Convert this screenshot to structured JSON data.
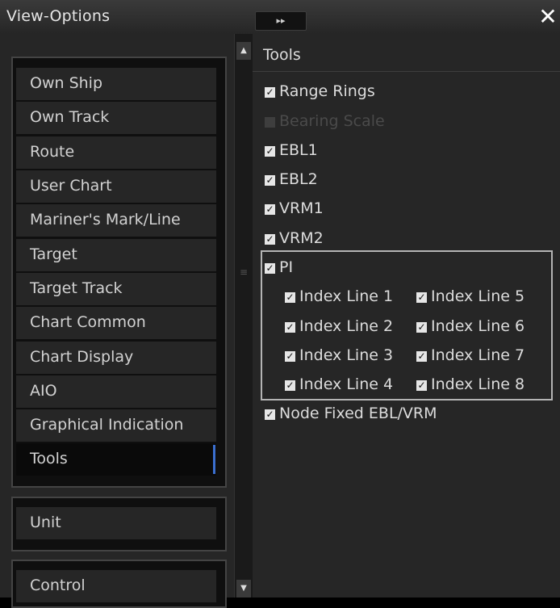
{
  "window": {
    "title": "View-Options",
    "collapse_label": "▸▸",
    "close_label": "✕"
  },
  "menu": {
    "items": [
      {
        "label": "Own Ship"
      },
      {
        "label": "Own Track"
      },
      {
        "label": "Route"
      },
      {
        "label": "User Chart"
      },
      {
        "label": "Mariner's Mark/Line"
      },
      {
        "label": "Target"
      },
      {
        "label": "Target Track"
      },
      {
        "label": "Chart Common"
      },
      {
        "label": "Chart Display"
      },
      {
        "label": "AIO"
      },
      {
        "label": "Graphical Indication"
      },
      {
        "label": "Tools",
        "selected": true
      }
    ],
    "unit_label": "Unit",
    "control_label": "Control"
  },
  "scrollbar": {
    "up_glyph": "▲",
    "down_glyph": "▼",
    "grip_glyph": "≡"
  },
  "tools": {
    "title": "Tools",
    "options": [
      {
        "label": "Range Rings",
        "checked": true,
        "enabled": true
      },
      {
        "label": "Bearing Scale",
        "checked": false,
        "enabled": false
      },
      {
        "label": "EBL1",
        "checked": true,
        "enabled": true
      },
      {
        "label": "EBL2",
        "checked": true,
        "enabled": true
      },
      {
        "label": "VRM1",
        "checked": true,
        "enabled": true
      },
      {
        "label": "VRM2",
        "checked": true,
        "enabled": true
      },
      {
        "label": "PI",
        "checked": true,
        "enabled": true
      },
      {
        "label": "Node Fixed EBL/VRM",
        "checked": true,
        "enabled": true
      }
    ],
    "index_lines": [
      {
        "label": "Index Line 1",
        "checked": true
      },
      {
        "label": "Index Line 2",
        "checked": true
      },
      {
        "label": "Index Line 3",
        "checked": true
      },
      {
        "label": "Index Line 4",
        "checked": true
      },
      {
        "label": "Index Line 5",
        "checked": true
      },
      {
        "label": "Index Line 6",
        "checked": true
      },
      {
        "label": "Index Line 7",
        "checked": true
      },
      {
        "label": "Index Line 8",
        "checked": true
      }
    ]
  },
  "colors": {
    "background": "#262626",
    "selection_accent": "#3b6fd0",
    "highlight_border": "#b4b4b4"
  }
}
